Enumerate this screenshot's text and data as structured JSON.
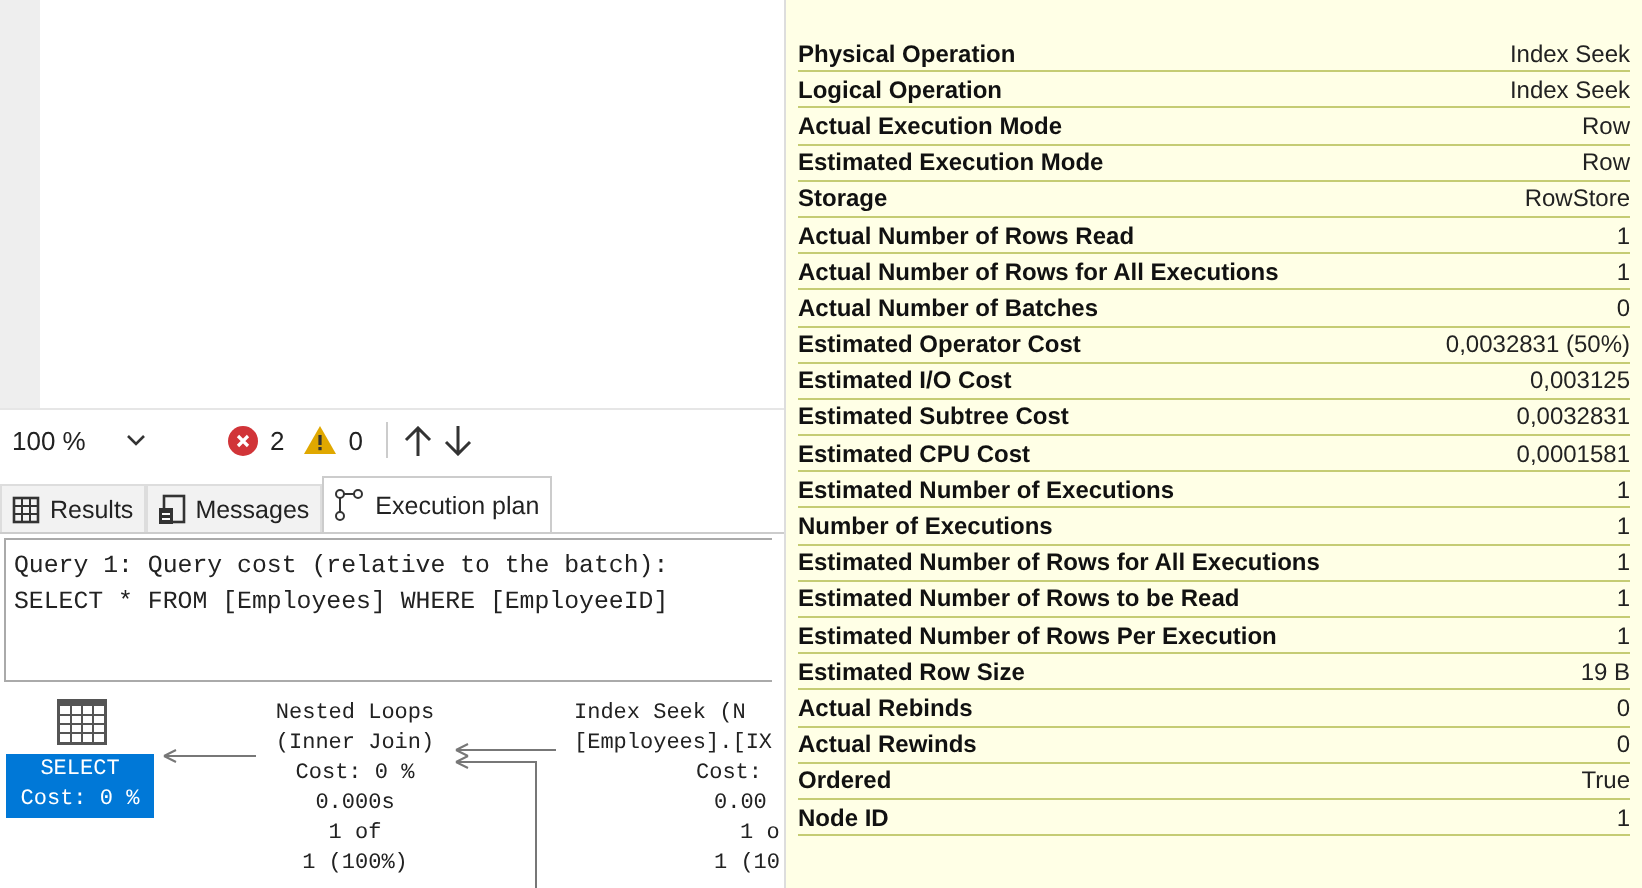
{
  "toolbar": {
    "zoom": "100 %",
    "errors": "2",
    "warnings": "0"
  },
  "tabs": [
    {
      "label": "Results",
      "selected": false
    },
    {
      "label": "Messages",
      "selected": false
    },
    {
      "label": "Execution plan",
      "selected": true
    }
  ],
  "query_text": [
    "Query 1: Query cost (relative to the batch):",
    "SELECT * FROM [Employees] WHERE [EmployeeID]"
  ],
  "plan_nodes": [
    {
      "kind": "select",
      "selected": true,
      "lines": [
        "SELECT",
        "Cost: 0 %"
      ]
    },
    {
      "kind": "operator",
      "selected": false,
      "lines": [
        "Nested Loops",
        "(Inner Join)",
        "Cost: 0 %",
        "0.000s",
        "1 of",
        "1 (100%)"
      ]
    },
    {
      "kind": "operator",
      "selected": false,
      "lines": [
        "Index Seek (N",
        "[Employees].[IX",
        "Cost:",
        "0.00",
        "1 o",
        "1 (10"
      ]
    }
  ],
  "properties": [
    {
      "name": "Physical Operation",
      "value": "Index Seek"
    },
    {
      "name": "Logical Operation",
      "value": "Index Seek"
    },
    {
      "name": "Actual Execution Mode",
      "value": "Row"
    },
    {
      "name": "Estimated Execution Mode",
      "value": "Row"
    },
    {
      "name": "Storage",
      "value": "RowStore"
    },
    {
      "name": "Actual Number of Rows Read",
      "value": "1"
    },
    {
      "name": "Actual Number of Rows for All Executions",
      "value": "1"
    },
    {
      "name": "Actual Number of Batches",
      "value": "0"
    },
    {
      "name": "Estimated Operator Cost",
      "value": "0,0032831 (50%)"
    },
    {
      "name": "Estimated I/O Cost",
      "value": "0,003125"
    },
    {
      "name": "Estimated Subtree Cost",
      "value": "0,0032831"
    },
    {
      "name": "Estimated CPU Cost",
      "value": "0,0001581"
    },
    {
      "name": "Estimated Number of Executions",
      "value": "1"
    },
    {
      "name": "Number of Executions",
      "value": "1"
    },
    {
      "name": "Estimated Number of Rows for All Executions",
      "value": "1"
    },
    {
      "name": "Estimated Number of Rows to be Read",
      "value": "1"
    },
    {
      "name": "Estimated Number of Rows Per Execution",
      "value": "1"
    },
    {
      "name": "Estimated Row Size",
      "value": "19 B"
    },
    {
      "name": "Actual Rebinds",
      "value": "0"
    },
    {
      "name": "Actual Rewinds",
      "value": "0"
    },
    {
      "name": "Ordered",
      "value": "True"
    },
    {
      "name": "Node ID",
      "value": "1"
    }
  ]
}
